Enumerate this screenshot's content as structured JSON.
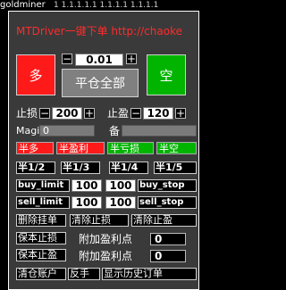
{
  "topbar": {
    "title": "goldminer",
    "numbers": "1 1.1.1.1.1  1.1.1.1  1.1.1.1"
  },
  "header": {
    "text": "MTDriver一键下单   http://chaoke"
  },
  "trade": {
    "buy_label": "多",
    "sell_label": "空",
    "close_all_label": "平仓全部",
    "lot_value": "0.01",
    "minus": "−",
    "plus": "+"
  },
  "sl_tp": {
    "sl_label": "止损",
    "sl_value": "200",
    "tp_label": "止盈",
    "tp_value": "120"
  },
  "magic": {
    "magic_label": "Magi",
    "magic_value": "0",
    "note_label": "备"
  },
  "half_buttons": [
    "半多",
    "半盈利",
    "半亏损",
    "半空"
  ],
  "fraction_buttons": [
    "半1/2",
    "半1/3",
    "半1/4",
    "半1/5"
  ],
  "limit_rows": [
    {
      "left": "buy_limit",
      "v1": "100",
      "v2": "100",
      "right": "buy_stop"
    },
    {
      "left": "sell_limit",
      "v1": "100",
      "v2": "100",
      "right": "sell_stop"
    }
  ],
  "actions": {
    "delete_pending": "删除挂单",
    "clear_sl": "清除止损",
    "clear_tp": "清除止盈",
    "protect_sl": "保本止损",
    "protect_tp": "保本止盈",
    "add_tp_label_1": "附加盈利点",
    "add_tp_value_1": "0",
    "add_tp_label_2": "附加盈利点",
    "add_tp_value_2": "0",
    "close_account": "清仓账户",
    "reverse": "反手",
    "show_history": "显示历史订单"
  },
  "colors": {
    "buy": "#ff1a1a",
    "sell": "#00b400",
    "close_all": "#808080",
    "panel": "#3a3a3a"
  }
}
